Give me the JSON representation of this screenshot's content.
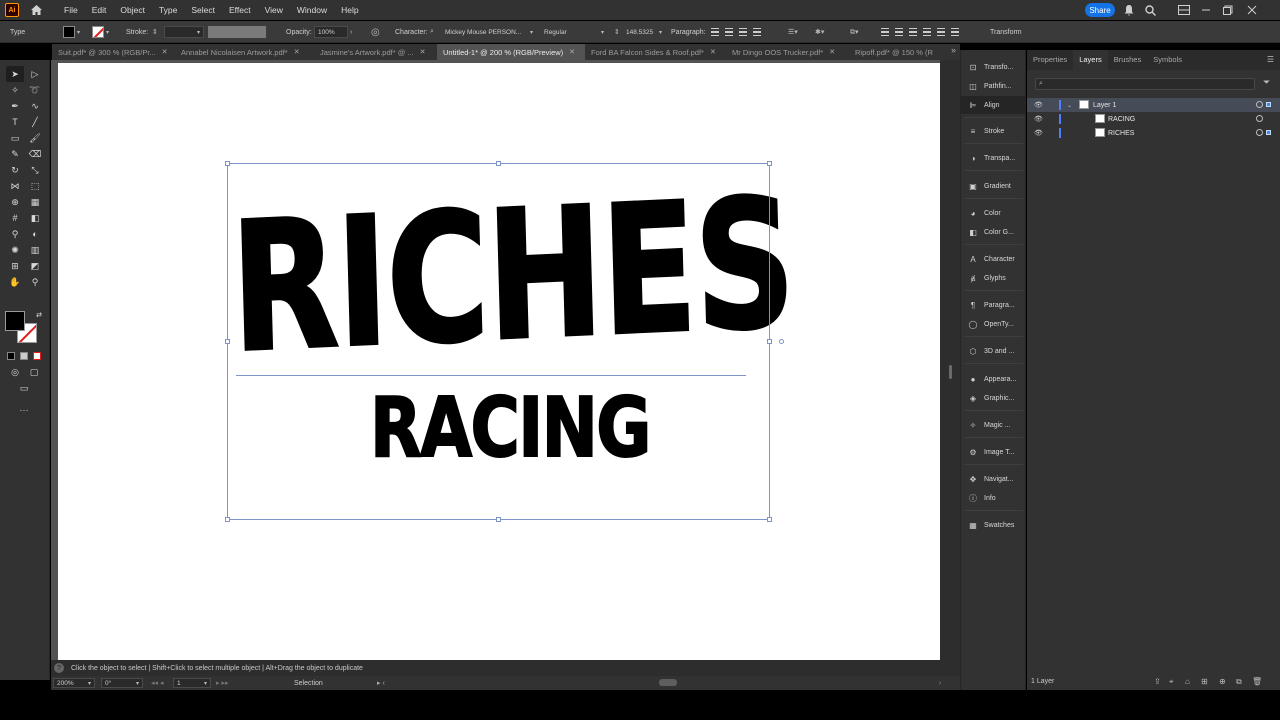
{
  "app": {
    "logo": "Ai",
    "menus": [
      "File",
      "Edit",
      "Object",
      "Type",
      "Select",
      "Effect",
      "View",
      "Window",
      "Help"
    ],
    "share_label": "Share"
  },
  "control_bar": {
    "tool_name": "Type",
    "stroke_label": "Stroke:",
    "opacity_label": "Opacity:",
    "opacity_value": "100%",
    "character_label": "Character:",
    "font_name": "Mickey Mouse PERSON...",
    "font_style": "Regular",
    "font_size": "148.5325",
    "paragraph_label": "Paragraph:",
    "transform_label": "Transform"
  },
  "tabs": [
    {
      "label": "Suit.pdf* @ 300 % (RGB/Pr...",
      "active": false
    },
    {
      "label": "Annabel Nicolaisen Artwork.pdf*",
      "active": false
    },
    {
      "label": "Jasmine's Artwork.pdf* @ ...",
      "active": false
    },
    {
      "label": "Untitled-1* @ 200 % (RGB/Preview)",
      "active": true
    },
    {
      "label": "Ford BA Falcon Sides & Roof.pdf*",
      "active": false
    },
    {
      "label": "Mr Dingo OOS Trucker.pdf*",
      "active": false
    },
    {
      "label": "Ripoff.pdf* @ 150 % (R",
      "active": false
    }
  ],
  "artwork": {
    "line1": "RICHES",
    "line2": "RACING"
  },
  "hint_bar": {
    "text": "Click the object to select  |  Shift+Click to select multiple object  |  Alt+Drag the object to duplicate"
  },
  "status_bar": {
    "zoom": "200%",
    "rotation": "0°",
    "artboard": "1",
    "tool": "Selection"
  },
  "panel_dock": [
    {
      "label": "Transfo...",
      "icon": "transform-icon"
    },
    {
      "label": "Pathfin...",
      "icon": "pathfinder-icon"
    },
    {
      "label": "Align",
      "icon": "align-icon",
      "active": true
    },
    {
      "label": "Stroke",
      "icon": "stroke-icon"
    },
    {
      "label": "Transpa...",
      "icon": "transparency-icon"
    },
    {
      "label": "Gradient",
      "icon": "gradient-icon"
    },
    {
      "label": "Color",
      "icon": "color-icon"
    },
    {
      "label": "Color G...",
      "icon": "color-guide-icon"
    },
    {
      "label": "Character",
      "icon": "character-icon"
    },
    {
      "label": "Glyphs",
      "icon": "glyphs-icon"
    },
    {
      "label": "Paragra...",
      "icon": "paragraph-icon"
    },
    {
      "label": "OpenTy...",
      "icon": "opentype-icon"
    },
    {
      "label": "3D and ...",
      "icon": "3d-icon"
    },
    {
      "label": "Appeara...",
      "icon": "appearance-icon"
    },
    {
      "label": "Graphic...",
      "icon": "graphic-styles-icon"
    },
    {
      "label": "Magic ...",
      "icon": "magic-wand-icon"
    },
    {
      "label": "Image T...",
      "icon": "image-trace-icon"
    },
    {
      "label": "Navigat...",
      "icon": "navigator-icon"
    },
    {
      "label": "Info",
      "icon": "info-icon"
    },
    {
      "label": "Swatches",
      "icon": "swatches-icon"
    }
  ],
  "right_panel": {
    "tabs": [
      "Properties",
      "Layers",
      "Brushes",
      "Symbols"
    ],
    "active_tab": "Layers",
    "layers": [
      {
        "name": "Layer 1",
        "level": 0
      },
      {
        "name": "RACING",
        "level": 1
      },
      {
        "name": "RICHES",
        "level": 1
      }
    ],
    "footer": "1 Layer"
  },
  "colors": {
    "accent": "#1473e6",
    "selection": "#7e94c8",
    "layer_color": "#4f7fff"
  }
}
